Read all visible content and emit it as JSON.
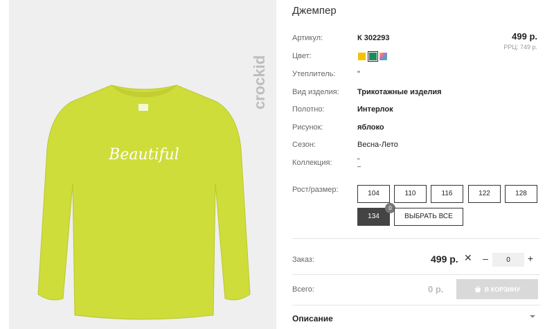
{
  "product": {
    "title": "Джемпер",
    "brand": "crockid",
    "print_text": "Beautiful"
  },
  "details": {
    "article_label": "Артикул:",
    "article_value": "К 302293",
    "color_label": "Цвет:",
    "insulation_label": "Утеплитель:",
    "insulation_value": "\"",
    "type_label": "Вид изделия:",
    "type_value": "Трикотажные изделия",
    "fabric_label": "Полотно:",
    "fabric_value": "Интерлок",
    "pattern_label": "Рисунок:",
    "pattern_value": "яблоко",
    "season_label": "Сезон:",
    "season_value": "Весна-Лето",
    "collection_label": "Коллекция:",
    "collection_value_1": "\"",
    "collection_value_2": "–"
  },
  "colors": {
    "swatches": [
      "#f4c300",
      "#1e8a5a",
      "multicolor"
    ],
    "selected_index": 1
  },
  "pricing": {
    "price": "499 р.",
    "rrp": "РРЦ: 749 р."
  },
  "sizes": {
    "label": "Рост/размер:",
    "options": [
      "104",
      "110",
      "116",
      "122",
      "128",
      "134"
    ],
    "selected": "134",
    "badge": "0",
    "select_all_label": "ВЫБРАТЬ ВСЕ"
  },
  "order": {
    "label": "Заказ:",
    "price": "499 р.",
    "times": "✕",
    "minus": "–",
    "qty": "0",
    "plus": "+",
    "total_label": "Всего:",
    "total_value": "0 р.",
    "cart_label": "В КОРЗИНУ"
  },
  "description": {
    "label": "Описание"
  },
  "style": {
    "shirt_color": "#cedd3a",
    "accent_dark": "#444444"
  }
}
